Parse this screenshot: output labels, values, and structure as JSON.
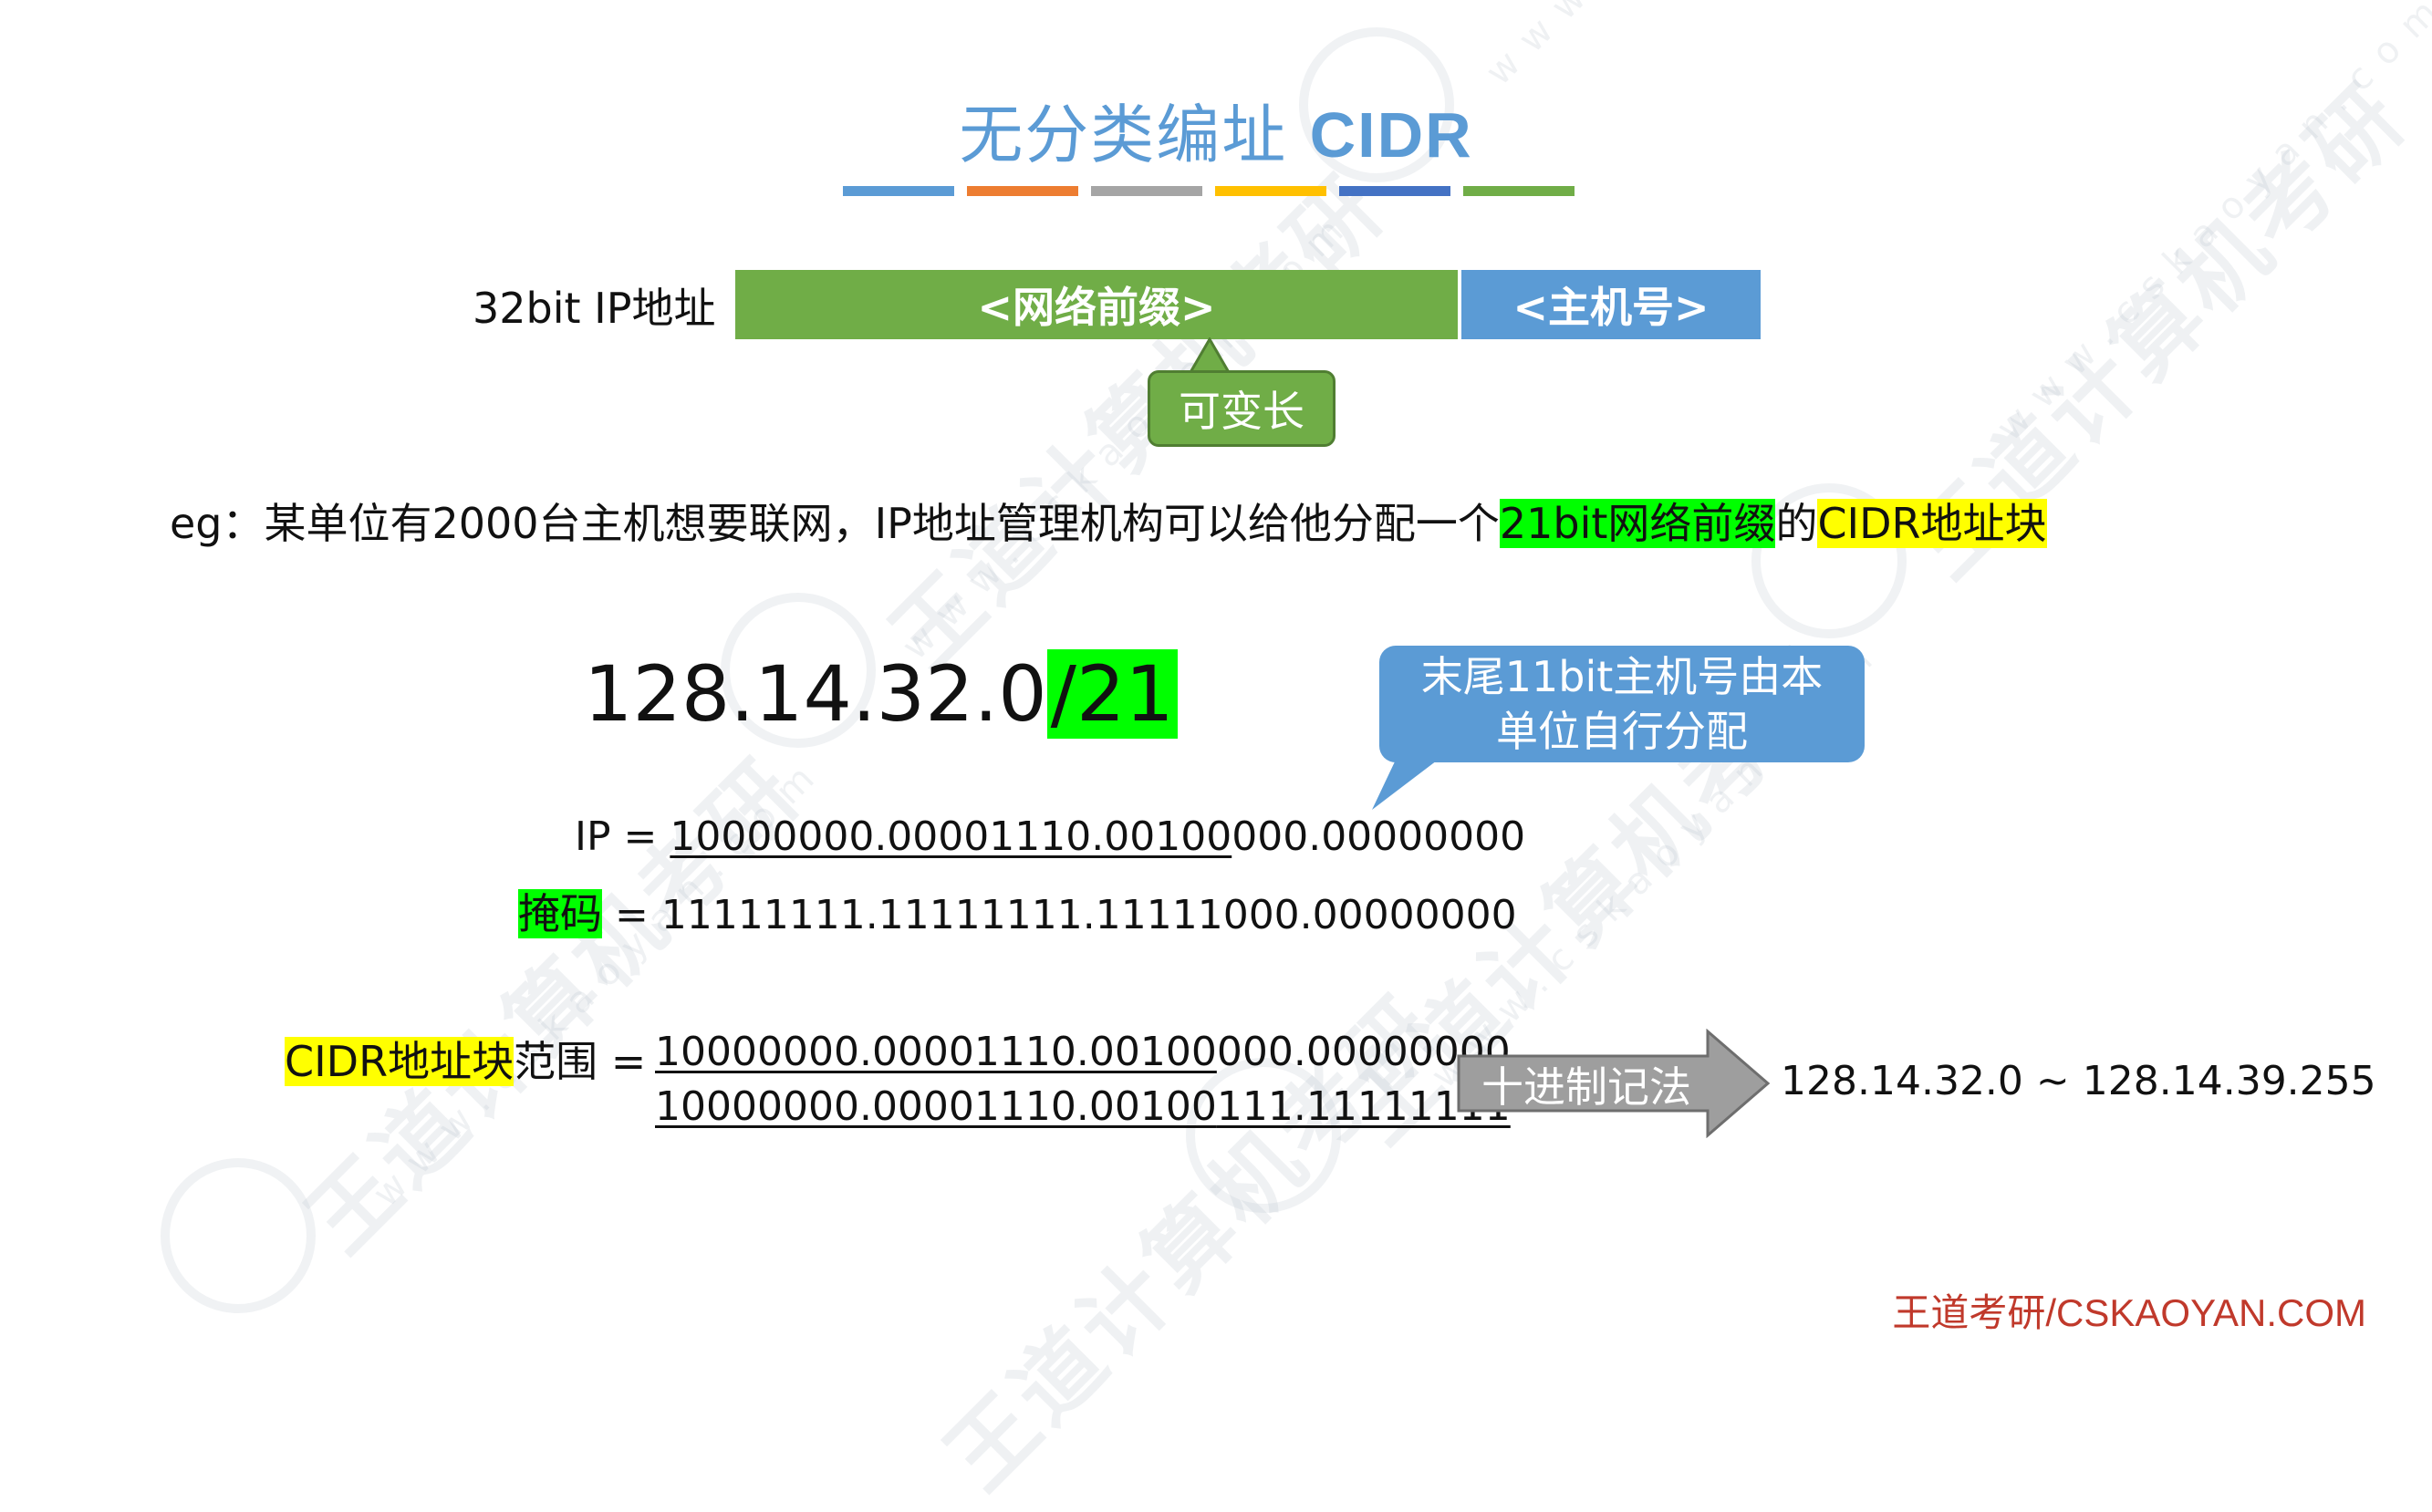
{
  "title": {
    "cn": "无分类编址",
    "en": "CIDR"
  },
  "stripes": [
    "#5b9bd5",
    "#ed7d31",
    "#a5a5a5",
    "#ffc000",
    "#4472c4",
    "#70ad47"
  ],
  "ip_bar": {
    "label": "32bit IP地址",
    "network": "<网络前缀>",
    "host": "<主机号>",
    "callout": "可变长"
  },
  "example": {
    "prefix": "eg：某单位有2000台主机想要联网，IP地址管理机构可以给他分配一个",
    "hl1": "21bit网络前缀",
    "mid": "的",
    "hl2": "CIDR地址块"
  },
  "address": {
    "base": "128.14.32.0",
    "suffix": "/21"
  },
  "callout_host": {
    "line1": "末尾11bit主机号由本",
    "line2": "单位自行分配"
  },
  "ip_row": {
    "label": "IP = ",
    "net_part": "10000000.00001110.00100",
    "rest": "000.00000000"
  },
  "mask_row": {
    "label": "掩码",
    "eq": " = ",
    "value": "11111111.11111111.11111000.00000000"
  },
  "range": {
    "label_hl": "CIDR地址块",
    "label_rest": "范围 = ",
    "line1_net": "10000000.00001110.00100",
    "line1_rest": "000.00000000",
    "line2_net": "10000000.00001110.00100",
    "line2_rest": "111.11111111"
  },
  "arrow": {
    "label": "十进制记法"
  },
  "decimal_range": "128.14.32.0 ~ 128.14.39.255",
  "watermark": {
    "brand": "王道计算机考研",
    "url": "www.cskaoyan.com"
  },
  "footer": "王道考研/CSKAOYAN.COM"
}
